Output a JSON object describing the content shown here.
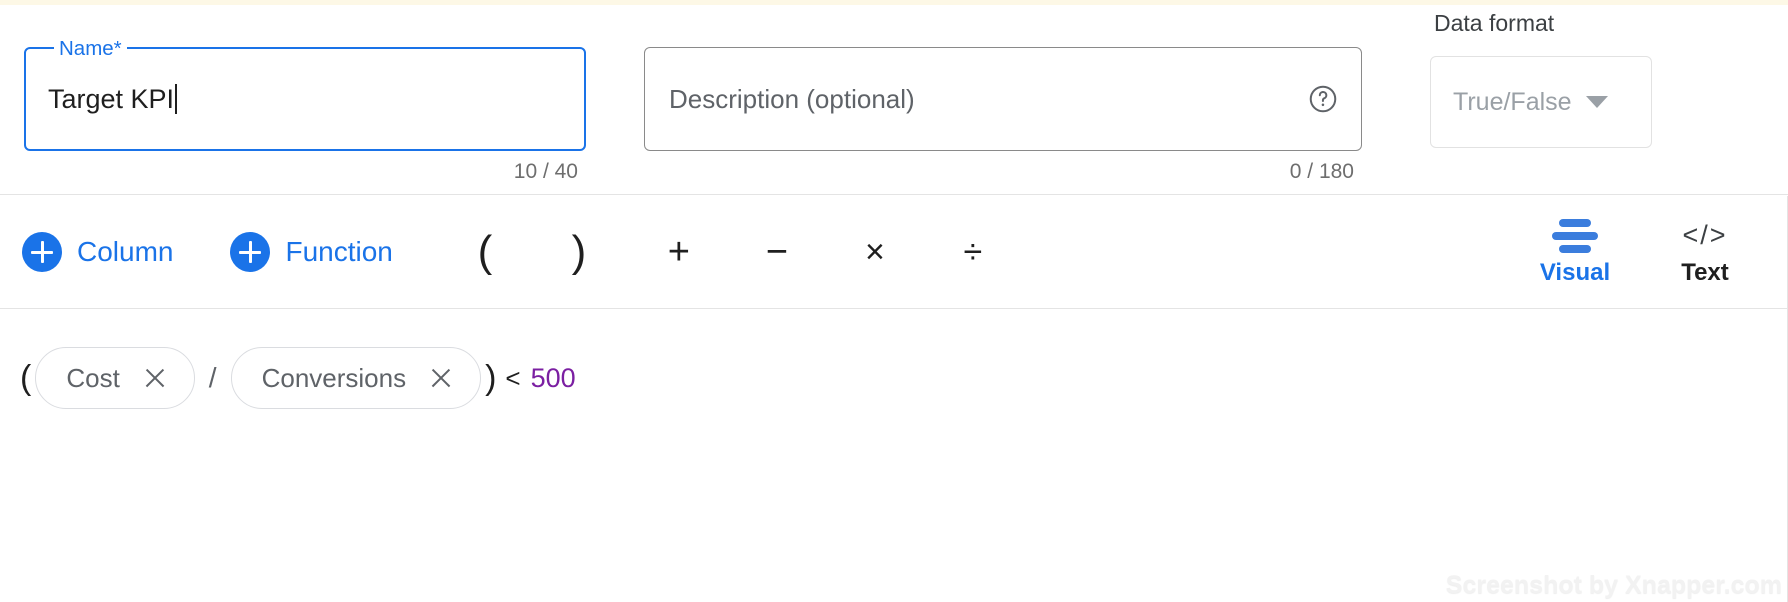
{
  "name_field": {
    "label": "Name*",
    "value": "Target KPI",
    "counter": "10 / 40"
  },
  "description_field": {
    "placeholder": "Description (optional)",
    "counter": "0 / 180",
    "help_icon": "help-circle-icon"
  },
  "data_format": {
    "label": "Data format",
    "value": "True/False",
    "caret_icon": "chevron-down-icon"
  },
  "toolbar": {
    "add_column_label": "Column",
    "add_function_label": "Function",
    "operators": [
      {
        "name": "open-paren",
        "glyph": "("
      },
      {
        "name": "close-paren",
        "glyph": ")"
      },
      {
        "name": "plus",
        "glyph": "+"
      },
      {
        "name": "minus",
        "glyph": "−"
      },
      {
        "name": "multiply",
        "glyph": "×"
      },
      {
        "name": "divide",
        "glyph": "÷"
      }
    ],
    "mode_visual_label": "Visual",
    "mode_text_label": "Text",
    "mode_text_icon": "</>",
    "active_mode": "Visual"
  },
  "formula": {
    "open_paren": "(",
    "close_paren": ")",
    "divider": "/",
    "comparator": "<",
    "number": "500",
    "chips": [
      {
        "label": "Cost"
      },
      {
        "label": "Conversions"
      }
    ]
  },
  "watermark": "Screenshot by Xnapper.com",
  "colors": {
    "accent_blue": "#1a73e8",
    "number_purple": "#7b1fa2",
    "muted_grey": "#5f6368",
    "top_strip": "#fdf8e6"
  }
}
